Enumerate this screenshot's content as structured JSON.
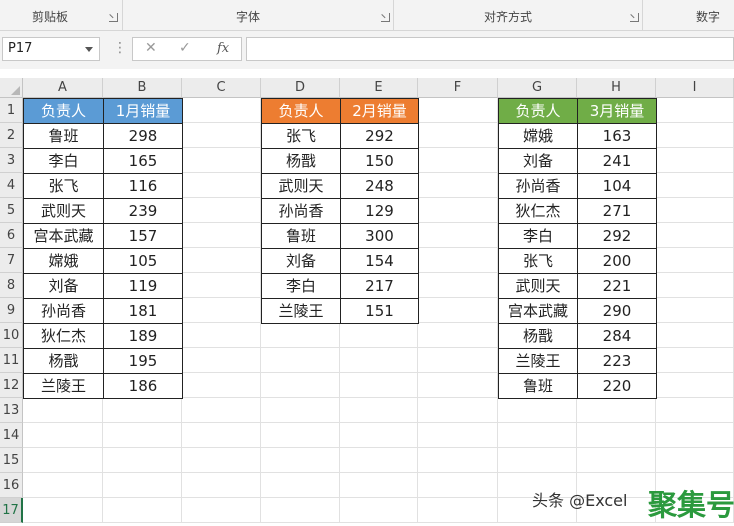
{
  "ribbon": {
    "groups": [
      {
        "label": "剪贴板"
      },
      {
        "label": "字体"
      },
      {
        "label": "对齐方式"
      },
      {
        "label": "数字"
      }
    ]
  },
  "formula_bar": {
    "name_box": "P17",
    "formula": ""
  },
  "columns": [
    "A",
    "B",
    "C",
    "D",
    "E",
    "F",
    "G",
    "H",
    "I"
  ],
  "rows": [
    "1",
    "2",
    "3",
    "4",
    "5",
    "6",
    "7",
    "8",
    "9",
    "10",
    "11",
    "12",
    "13",
    "14",
    "15",
    "16",
    "17"
  ],
  "tables": [
    {
      "headers": [
        "负责人",
        "1月销量"
      ],
      "header_color": "#5b9bd5",
      "rows": [
        [
          "鲁班",
          "298"
        ],
        [
          "李白",
          "165"
        ],
        [
          "张飞",
          "116"
        ],
        [
          "武则天",
          "239"
        ],
        [
          "宫本武藏",
          "157"
        ],
        [
          "嫦娥",
          "105"
        ],
        [
          "刘备",
          "119"
        ],
        [
          "孙尚香",
          "181"
        ],
        [
          "狄仁杰",
          "189"
        ],
        [
          "杨戬",
          "195"
        ],
        [
          "兰陵王",
          "186"
        ]
      ]
    },
    {
      "headers": [
        "负责人",
        "2月销量"
      ],
      "header_color": "#ed7d31",
      "rows": [
        [
          "张飞",
          "292"
        ],
        [
          "杨戬",
          "150"
        ],
        [
          "武则天",
          "248"
        ],
        [
          "孙尚香",
          "129"
        ],
        [
          "鲁班",
          "300"
        ],
        [
          "刘备",
          "154"
        ],
        [
          "李白",
          "217"
        ],
        [
          "兰陵王",
          "151"
        ]
      ]
    },
    {
      "headers": [
        "负责人",
        "3月销量"
      ],
      "header_color": "#70ad47",
      "rows": [
        [
          "嫦娥",
          "163"
        ],
        [
          "刘备",
          "241"
        ],
        [
          "孙尚香",
          "104"
        ],
        [
          "狄仁杰",
          "271"
        ],
        [
          "李白",
          "292"
        ],
        [
          "张飞",
          "200"
        ],
        [
          "武则天",
          "221"
        ],
        [
          "宫本武藏",
          "290"
        ],
        [
          "杨戬",
          "284"
        ],
        [
          "兰陵王",
          "223"
        ],
        [
          "鲁班",
          "220"
        ]
      ]
    }
  ],
  "watermark": {
    "text": "头条 @Excel",
    "logo": "聚集号"
  },
  "active_row": "17"
}
